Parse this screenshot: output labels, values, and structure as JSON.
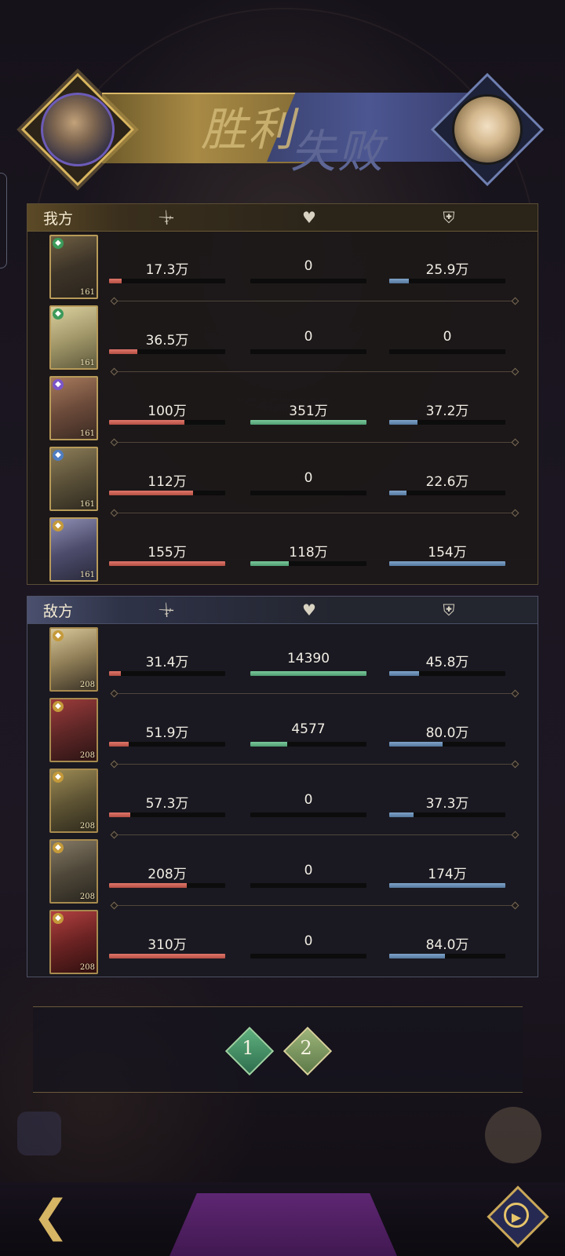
{
  "header": {
    "victory_text": "胜利",
    "defeat_text": "失败"
  },
  "columns": {
    "damage_icon": "sword-icon",
    "heal_icon": "heart-heal-icon",
    "defense_icon": "shield-icon"
  },
  "colors": {
    "damage": "#c85a4f",
    "heal": "#63b386",
    "defense": "#6e93bb",
    "gold": "#d9b660"
  },
  "ally": {
    "title": "我方",
    "rows": [
      {
        "level": "161",
        "element": "green",
        "damage": "17.3万",
        "damage_ratio": 0.11,
        "heal": "0",
        "heal_ratio": 0,
        "defense": "25.9万",
        "defense_ratio": 0.17
      },
      {
        "level": "161",
        "element": "green",
        "damage": "36.5万",
        "damage_ratio": 0.24,
        "heal": "0",
        "heal_ratio": 0,
        "defense": "0",
        "defense_ratio": 0
      },
      {
        "level": "161",
        "element": "purple",
        "damage": "100万",
        "damage_ratio": 0.65,
        "heal": "351万",
        "heal_ratio": 1.0,
        "defense": "37.2万",
        "defense_ratio": 0.24
      },
      {
        "level": "161",
        "element": "blue",
        "damage": "112万",
        "damage_ratio": 0.72,
        "heal": "0",
        "heal_ratio": 0,
        "defense": "22.6万",
        "defense_ratio": 0.15
      },
      {
        "level": "161",
        "element": "gold",
        "damage": "155万",
        "damage_ratio": 1.0,
        "heal": "118万",
        "heal_ratio": 0.33,
        "defense": "154万",
        "defense_ratio": 1.0
      }
    ]
  },
  "enemy": {
    "title": "敌方",
    "rows": [
      {
        "level": "208",
        "element": "gold",
        "damage": "31.4万",
        "damage_ratio": 0.1,
        "heal": "14390",
        "heal_ratio": 1.0,
        "defense": "45.8万",
        "defense_ratio": 0.26
      },
      {
        "level": "208",
        "element": "gold",
        "damage": "51.9万",
        "damage_ratio": 0.17,
        "heal": "4577",
        "heal_ratio": 0.32,
        "defense": "80.0万",
        "defense_ratio": 0.46
      },
      {
        "level": "208",
        "element": "gold",
        "damage": "57.3万",
        "damage_ratio": 0.18,
        "heal": "0",
        "heal_ratio": 0,
        "defense": "37.3万",
        "defense_ratio": 0.21
      },
      {
        "level": "208",
        "element": "gold",
        "damage": "208万",
        "damage_ratio": 0.67,
        "heal": "0",
        "heal_ratio": 0,
        "defense": "174万",
        "defense_ratio": 1.0
      },
      {
        "level": "208",
        "element": "gold",
        "damage": "310万",
        "damage_ratio": 1.0,
        "heal": "0",
        "heal_ratio": 0,
        "defense": "84.0万",
        "defense_ratio": 0.48
      }
    ]
  },
  "pager": {
    "pages": [
      "1",
      "2"
    ],
    "current": "1"
  },
  "footer": {
    "back_icon": "back-arrow-icon",
    "replay_icon": "replay-icon"
  }
}
